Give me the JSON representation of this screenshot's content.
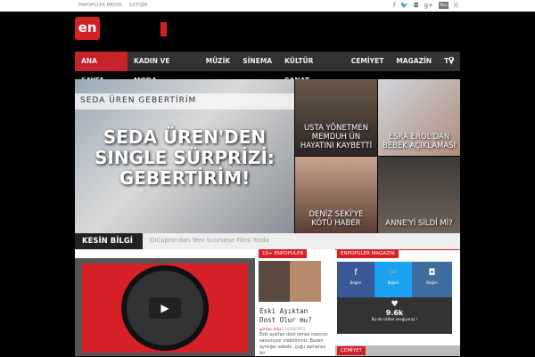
{
  "topbar": {
    "links": [
      "ENPOPULER MEDYA",
      "İLETİŞİM"
    ],
    "social": [
      "f",
      "t",
      "ig",
      "g+",
      "YouTube",
      "rss"
    ]
  },
  "logo": "en",
  "nav": {
    "items": [
      "ANA SAYFA",
      "KADIN VE MODA",
      "MÜZİK",
      "SİNEMA",
      "KÜLTÜR SANAT",
      "CEMİYET",
      "MAGAZİN",
      "TV"
    ]
  },
  "hero": {
    "image_text": "SEDA ÜREN     GEBERTİRİM",
    "title": "SEDA ÜREN'DEN SINGLE SÜRPRİZİ: GEBERTİRİM!"
  },
  "tiles": [
    {
      "title": "USTA YÖNETMEN MEMDUH ÜN HAYATINI KAYBETTİ"
    },
    {
      "title": "ESRA EROL'DAN BEBEK AÇIKLAMASI"
    },
    {
      "title": "DENİZ SEKİ'YE KÖTÜ HABER"
    },
    {
      "title": "ANNE'Yİ SİLDİ Mİ?"
    }
  ],
  "ticker": {
    "label": "KESİN BİLGİ",
    "text": "DiCaprio'dan Yeni Scorsese Filmi Yolda"
  },
  "popular": {
    "header": "10+ ENPOPULER",
    "title": "Eski Aşıktan Dost Olur mu?",
    "author": "gürkan acka",
    "date": "10/08/2015",
    "excerpt": "Eski aşıktan dost olmaz inancını savunuyor olabilirsiniz. Bazen ayrılığın sebebi, çoğu zamansa bir"
  },
  "magazin": {
    "header": "ENPOPULER MAGAZIN",
    "like_label": "Beğen",
    "count": "9.6k",
    "count_caption": "Bu da sizden sevgiyoruz !"
  },
  "cemiyet": {
    "header": "CEMİYET"
  },
  "colors": {
    "accent": "#d62027",
    "nav": "#333333"
  }
}
